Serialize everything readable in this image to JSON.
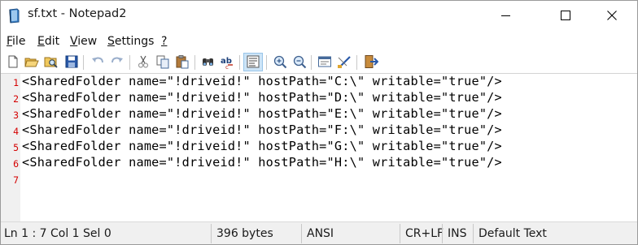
{
  "window": {
    "title": "sf.txt - Notepad2",
    "minimize_icon": "minimize-icon",
    "maximize_icon": "maximize-icon",
    "close_icon": "close-icon"
  },
  "menu": {
    "items": [
      {
        "key": "F",
        "rest": "ile"
      },
      {
        "key": "E",
        "rest": "dit"
      },
      {
        "key": "V",
        "rest": "iew"
      },
      {
        "key": "S",
        "rest": "ettings"
      },
      {
        "key": "?",
        "rest": ""
      }
    ]
  },
  "toolbar": {
    "buttons": [
      "new-file-icon",
      "open-file-icon",
      "browse-icon",
      "save-icon",
      "undo-icon",
      "redo-icon",
      "cut-icon",
      "copy-icon",
      "paste-icon",
      "find-icon",
      "replace-icon",
      "word-wrap-icon",
      "zoom-in-icon",
      "zoom-out-icon",
      "scheme-icon",
      "customize-scheme-icon",
      "exit-icon"
    ]
  },
  "editor": {
    "lines": [
      {
        "num": "1",
        "text": "<SharedFolder name=\"!driveid!\" hostPath=\"C:\\\" writable=\"true\"/>"
      },
      {
        "num": "2",
        "text": "<SharedFolder name=\"!driveid!\" hostPath=\"D:\\\" writable=\"true\"/>"
      },
      {
        "num": "3",
        "text": "<SharedFolder name=\"!driveid!\" hostPath=\"E:\\\" writable=\"true\"/>"
      },
      {
        "num": "4",
        "text": "<SharedFolder name=\"!driveid!\" hostPath=\"F:\\\" writable=\"true\"/>"
      },
      {
        "num": "5",
        "text": "<SharedFolder name=\"!driveid!\" hostPath=\"G:\\\" writable=\"true\"/>"
      },
      {
        "num": "6",
        "text": "<SharedFolder name=\"!driveid!\" hostPath=\"H:\\\" writable=\"true\"/>"
      },
      {
        "num": "7",
        "text": ""
      }
    ],
    "line_number_color": "#d40000"
  },
  "status": {
    "position": "Ln 1 : 7   Col 1   Sel 0",
    "size": "396 bytes",
    "encoding": "ANSI",
    "line_ending": "CR+LF",
    "insert_mode": "INS",
    "scheme": "Default Text"
  }
}
